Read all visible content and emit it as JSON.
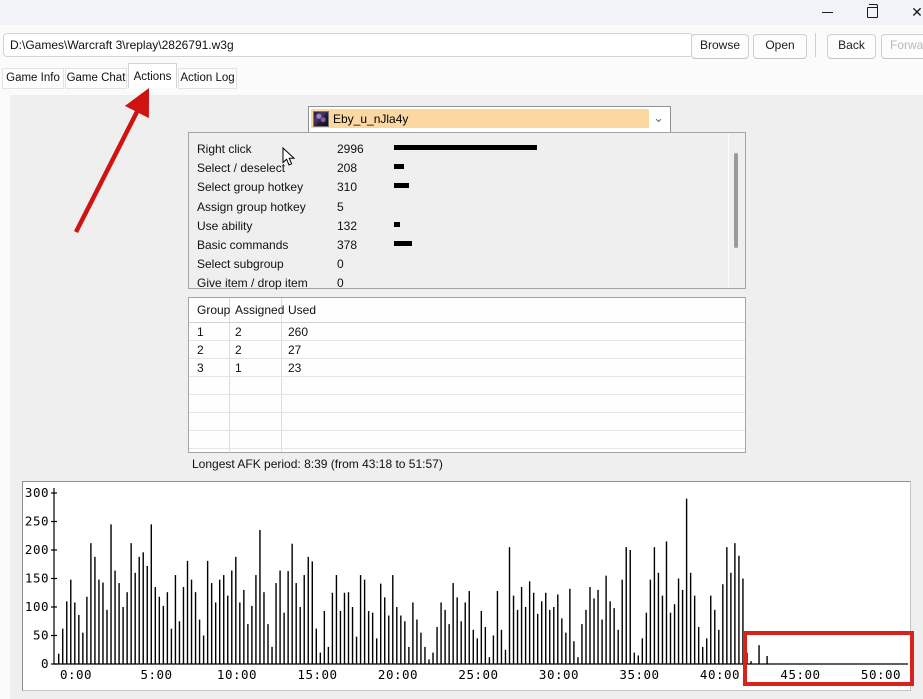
{
  "window": {
    "icons": {
      "minimize": "minimize-dash",
      "restore": "overlapping-squares",
      "close": "✕",
      "chevron_down": "⌄"
    }
  },
  "toolbar": {
    "path_value": "D:\\Games\\Warcraft 3\\replay\\2826791.w3g",
    "browse_label": "Browse",
    "open_label": "Open",
    "back_label": "Back",
    "forward_label": "Forward"
  },
  "tabs": [
    {
      "label": "Game Info",
      "active": false
    },
    {
      "label": "Game Chat",
      "active": false
    },
    {
      "label": "Actions",
      "active": true
    },
    {
      "label": "Action Log",
      "active": false
    }
  ],
  "player_select": {
    "value": "Eby_u_nJla4y",
    "icon": "player-portrait",
    "highlight_color": "#fbd7a2"
  },
  "actions_panel": {
    "rows": [
      {
        "label": "Right click",
        "count": 2996
      },
      {
        "label": "Select / deselect",
        "count": 208
      },
      {
        "label": "Select group hotkey",
        "count": 310
      },
      {
        "label": "Assign group hotkey",
        "count": 5
      },
      {
        "label": "Use ability",
        "count": 132
      },
      {
        "label": "Basic commands",
        "count": 378
      },
      {
        "label": "Select subgroup",
        "count": 0
      },
      {
        "label": "Give item / drop item",
        "count": 0
      }
    ]
  },
  "groups_table": {
    "columns": [
      "Group",
      "Assigned",
      "Used"
    ],
    "rows": [
      [
        "1",
        "2",
        "260"
      ],
      [
        "2",
        "2",
        "27"
      ],
      [
        "3",
        "1",
        "23"
      ]
    ],
    "empty_row_count": 4
  },
  "afk_text": "Longest AFK period: 8:39 (from 43:18 to 51:57)",
  "chart_data": {
    "type": "bar",
    "title": "",
    "xlabel": "",
    "ylabel": "",
    "ylim": [
      0,
      300
    ],
    "yticks": [
      0,
      50,
      100,
      150,
      200,
      250,
      300
    ],
    "x_tick_minutes": [
      0,
      5,
      10,
      15,
      20,
      25,
      30,
      35,
      40,
      45,
      50
    ],
    "x_tick_labels": [
      "0:00",
      "5:00",
      "10:00",
      "15:00",
      "20:00",
      "25:00",
      "30:00",
      "35:00",
      "40:00",
      "45:00",
      "50:00"
    ],
    "bucket_seconds": 15,
    "grid": false,
    "bar_color": "#000000",
    "values": [
      18,
      62,
      110,
      148,
      108,
      86,
      55,
      118,
      212,
      188,
      148,
      143,
      95,
      245,
      164,
      142,
      100,
      126,
      212,
      160,
      188,
      196,
      172,
      245,
      135,
      118,
      102,
      126,
      62,
      156,
      75,
      135,
      181,
      148,
      126,
      78,
      50,
      181,
      142,
      108,
      148,
      156,
      120,
      164,
      188,
      108,
      130,
      70,
      102,
      156,
      235,
      126,
      70,
      30,
      142,
      164,
      90,
      163,
      211,
      142,
      100,
      156,
      188,
      180,
      62,
      20,
      93,
      30,
      125,
      156,
      93,
      125,
      126,
      100,
      48,
      156,
      148,
      93,
      90,
      45,
      141,
      117,
      85,
      156,
      100,
      85,
      75,
      30,
      108,
      78,
      55,
      30,
      8,
      20,
      65,
      108,
      95,
      70,
      142,
      117,
      75,
      108,
      128,
      60,
      45,
      93,
      65,
      12,
      50,
      128,
      60,
      25,
      205,
      120,
      95,
      135,
      100,
      145,
      125,
      88,
      110,
      125,
      95,
      100,
      122,
      80,
      55,
      132,
      40,
      12,
      70,
      95,
      135,
      115,
      130,
      78,
      155,
      110,
      98,
      60,
      148,
      205,
      200,
      20,
      15,
      45,
      90,
      148,
      205,
      160,
      120,
      215,
      90,
      105,
      150,
      130,
      290,
      160,
      120,
      65,
      30,
      45,
      120,
      95,
      60,
      140,
      205,
      160,
      212,
      190,
      150,
      20,
      5,
      0,
      33,
      0,
      14,
      0,
      0,
      0,
      0,
      0,
      0,
      0,
      0,
      0,
      0,
      0,
      0,
      0,
      0,
      0,
      0,
      0,
      0,
      0,
      0,
      0,
      0,
      0,
      0,
      0,
      0,
      0,
      0,
      0,
      0,
      0,
      0,
      0,
      0,
      0
    ]
  },
  "annotation_colors": {
    "arrow_red": "#cf1310",
    "highlight_red": "#d8221c"
  }
}
